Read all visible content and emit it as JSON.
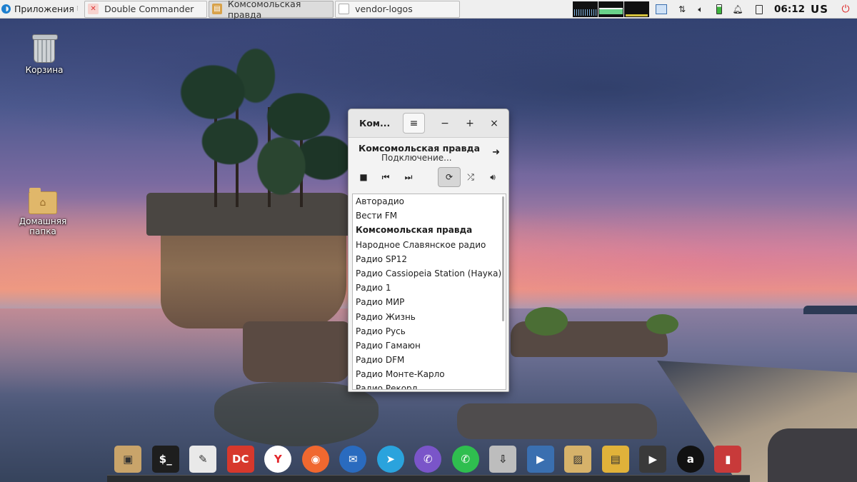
{
  "top_panel": {
    "apps_label": "Приложения",
    "tasks": [
      {
        "label": "Double Commander",
        "icon": "double-commander-icon"
      },
      {
        "label": "Комсомольская правда",
        "icon": "radio-tray-icon"
      },
      {
        "label": "vendor-logos",
        "icon": "text-file-icon"
      }
    ],
    "clock": "06:12",
    "keyboard_layout": "us"
  },
  "desktop_icons": [
    {
      "label": "Корзина",
      "icon": "trash-icon"
    },
    {
      "label": "Домашняя папка",
      "icon": "home-folder-icon"
    }
  ],
  "radio_window": {
    "title": "Ком...",
    "now_playing": {
      "station": "Комсомольская правда",
      "status": "Подключение..."
    },
    "stations": [
      "Авторадио",
      "Вести FM",
      "Комсомольская правда",
      "Народное Славянское радио",
      "Радио SP12",
      "Радио Cassiopeia Station (Наука)",
      "Радио 1",
      "Радио МИР",
      "Радио Жизнь",
      "Радио Русь",
      "Радио Гамаюн",
      "Радио DFM",
      "Радио Монте-Карло",
      "Радио Рекорд"
    ],
    "current_station_index": 2,
    "repeat_enabled": true
  },
  "dock": [
    {
      "name": "archive-manager-icon",
      "color": "#c9a46a"
    },
    {
      "name": "terminal-icon",
      "color": "#1e1e1e"
    },
    {
      "name": "text-editor-icon",
      "color": "#e9e9e9"
    },
    {
      "name": "double-commander-icon",
      "color": "#d7382c"
    },
    {
      "name": "yandex-browser-icon",
      "color": "#ffffff"
    },
    {
      "name": "firefox-icon",
      "color": "#f0682f"
    },
    {
      "name": "thunderbird-icon",
      "color": "#2a6bbf"
    },
    {
      "name": "telegram-icon",
      "color": "#2aa3dd"
    },
    {
      "name": "viber-icon",
      "color": "#7a55c9"
    },
    {
      "name": "whatsapp-icon",
      "color": "#2fbe4f"
    },
    {
      "name": "downloader-icon",
      "color": "#bdbdbd"
    },
    {
      "name": "video-editor-icon",
      "color": "#3a6fb0"
    },
    {
      "name": "image-viewer-icon",
      "color": "#d6b26a"
    },
    {
      "name": "radio-tray-icon",
      "color": "#e0b23a"
    },
    {
      "name": "media-player-icon",
      "color": "#3a3a3a"
    },
    {
      "name": "amazon-icon",
      "color": "#111111"
    },
    {
      "name": "book-reader-icon",
      "color": "#c83a3a"
    }
  ]
}
